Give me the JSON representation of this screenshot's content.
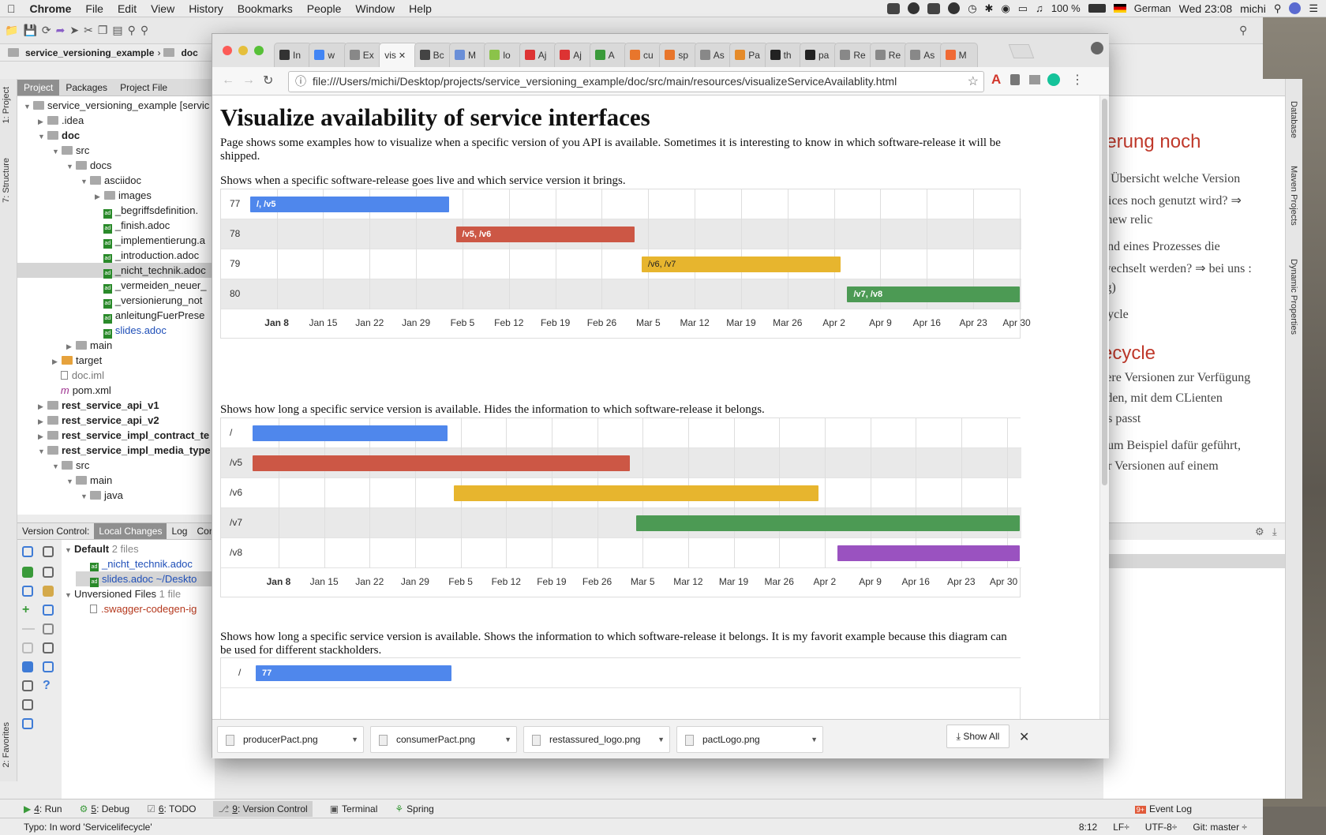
{
  "menubar": {
    "apple": "",
    "app": "Chrome",
    "items": [
      "File",
      "Edit",
      "View",
      "History",
      "Bookmarks",
      "People",
      "Window",
      "Help"
    ],
    "battery": "100 %",
    "input_lang": "German",
    "clock": "Wed 23:08",
    "user": "michi"
  },
  "ide": {
    "breadcrumb": [
      "service_versioning_example",
      "doc"
    ],
    "left_tabs": {
      "project": "1: Project",
      "structure": "7: Structure",
      "favorites": "2: Favorites"
    },
    "project_tabs": [
      "Project",
      "Packages",
      "Project File"
    ],
    "tree": [
      {
        "label": "service_versioning_example [servic",
        "depth": 0,
        "kind": "folder",
        "bold": false
      },
      {
        "label": ".idea",
        "depth": 1,
        "kind": "folder"
      },
      {
        "label": "doc",
        "depth": 1,
        "kind": "folder",
        "bold": true
      },
      {
        "label": "src",
        "depth": 2,
        "kind": "folder"
      },
      {
        "label": "docs",
        "depth": 3,
        "kind": "folder"
      },
      {
        "label": "asciidoc",
        "depth": 4,
        "kind": "folder"
      },
      {
        "label": "images",
        "depth": 5,
        "kind": "folder"
      },
      {
        "label": "_begriffsdefinition.",
        "depth": 5,
        "kind": "adoc"
      },
      {
        "label": "_finish.adoc",
        "depth": 5,
        "kind": "adoc"
      },
      {
        "label": "_implementierung.a",
        "depth": 5,
        "kind": "adoc"
      },
      {
        "label": "_introduction.adoc",
        "depth": 5,
        "kind": "adoc"
      },
      {
        "label": "_nicht_technik.adoc",
        "depth": 5,
        "kind": "adoc",
        "selected": true
      },
      {
        "label": "_vermeiden_neuer_",
        "depth": 5,
        "kind": "adoc"
      },
      {
        "label": "_versionierung_not",
        "depth": 5,
        "kind": "adoc"
      },
      {
        "label": "anleitungFuerPrese",
        "depth": 5,
        "kind": "adoc"
      },
      {
        "label": "slides.adoc",
        "depth": 5,
        "kind": "adoc",
        "blue": true
      },
      {
        "label": "main",
        "depth": 3,
        "kind": "folder"
      },
      {
        "label": "target",
        "depth": 2,
        "kind": "folder-orange"
      },
      {
        "label": "doc.iml",
        "depth": 2,
        "kind": "file"
      },
      {
        "label": "pom.xml",
        "depth": 2,
        "kind": "pom"
      },
      {
        "label": "rest_service_api_v1",
        "depth": 1,
        "kind": "folder",
        "bold": true
      },
      {
        "label": "rest_service_api_v2",
        "depth": 1,
        "kind": "folder",
        "bold": true
      },
      {
        "label": "rest_service_impl_contract_te",
        "depth": 1,
        "kind": "folder",
        "bold": true
      },
      {
        "label": "rest_service_impl_media_type",
        "depth": 1,
        "kind": "folder",
        "bold": true
      },
      {
        "label": "src",
        "depth": 2,
        "kind": "folder"
      },
      {
        "label": "main",
        "depth": 3,
        "kind": "folder"
      },
      {
        "label": "java",
        "depth": 4,
        "kind": "folder"
      }
    ],
    "vc_tabs": [
      "Version Control:",
      "Local Changes",
      "Log",
      "Con"
    ],
    "vc_list": {
      "default_label": "Default",
      "default_count": "2 files",
      "files": [
        "_nicht_technik.adoc",
        "slides.adoc ~/Deskto"
      ],
      "unversioned_label": "Unversioned Files",
      "unversioned_count": "1 file",
      "unversioned_files": [
        ".swagger-codegen-ig"
      ]
    },
    "bottom_tabs": [
      {
        "key": "4",
        "label": ": Run"
      },
      {
        "key": "5",
        "label": ": Debug"
      },
      {
        "key": "6",
        "label": ": TODO"
      },
      {
        "key": "9",
        "label": ": Version Control"
      },
      {
        "key": "",
        "label": "Terminal"
      },
      {
        "key": "",
        "label": "Spring"
      }
    ],
    "event_log": "Event Log",
    "status_text": "Typo: In word 'Servicelifecycle'",
    "status_right": [
      "8:12",
      "LF÷",
      "UTF-8÷",
      "Git: master ÷"
    ],
    "right_tabs": [
      "Database",
      "Maven Projects",
      "Dynamic Properties"
    ],
    "editor_lines": [
      {
        "text": "ierung noch",
        "style": "h"
      },
      {
        "text": "e Übersicht welche Version",
        "style": "p"
      },
      {
        "text": "vices noch genutzt wird? ⇒",
        "style": "p"
      },
      {
        "text": " (new relic",
        "style": "p"
      },
      {
        "text": "end eines Prozesses die",
        "style": "p"
      },
      {
        "text": "wechselt werden? ⇒ bei uns :",
        "style": "p"
      },
      {
        "text": "ig)",
        "style": "p"
      },
      {
        "text": "cycle",
        "style": "p"
      },
      {
        "text": "ecycle",
        "style": "h"
      },
      {
        "text": "rere Versionen zur Verfügung",
        "style": "p"
      },
      {
        "text": "rden, mit dem CLienten",
        "style": "p"
      },
      {
        "text": " es passt",
        "style": "p"
      },
      {
        "text": " zum Beispiel dafür geführt,",
        "style": "p"
      },
      {
        "text": "er Versionen auf einem",
        "style": "p"
      }
    ]
  },
  "browser": {
    "tabs": [
      "In",
      "w",
      "Ex",
      "vis",
      "Bc",
      "M",
      "lo",
      "Aj",
      "Aj",
      "A",
      "cu",
      "sp",
      "As",
      "Pa",
      "th",
      "pa",
      "Re",
      "Re",
      "As",
      "M"
    ],
    "active_tab": 3,
    "url": "file:///Users/michi/Desktop/projects/service_versioning_example/doc/src/main/resources/visualizeServiceAvailablity.html",
    "page_title": "Visualize availability of service interfaces",
    "intro": "Page shows some examples how to visualize when a specific version of you API is available. Sometimes it is interesting to know in which software-release it will be shipped.",
    "caption1": "Shows when a specific software-release goes live and which service version it brings.",
    "caption2": "Shows how long a specific service version is available. Hides the information to which software-release it belongs.",
    "caption3": "Shows how long a specific service version is available. Shows the information to which software-release it belongs. It is my favorit example because this diagram can be used for different stackholders.",
    "downloads": [
      "producerPact.png",
      "consumerPact.png",
      "restassured_logo.png",
      "pactLogo.png"
    ],
    "show_all": "Show All"
  },
  "chart_data": [
    {
      "type": "timeline",
      "x_ticks": [
        "Jan 8",
        "Jan 15",
        "Jan 22",
        "Jan 29",
        "Feb 5",
        "Feb 12",
        "Feb 19",
        "Feb 26",
        "Mar 5",
        "Mar 12",
        "Mar 19",
        "Mar 26",
        "Apr 2",
        "Apr 9",
        "Apr 16",
        "Apr 23",
        "Apr 30"
      ],
      "x_range": [
        "2017-01-04",
        "2017-04-30"
      ],
      "rows": [
        {
          "row": "77",
          "label": "/, /v5",
          "start": "2017-01-04",
          "end": "2017-02-03",
          "color": "#4f87ec"
        },
        {
          "row": "78",
          "label": "/v5, /v6",
          "start": "2017-02-04",
          "end": "2017-03-03",
          "color": "#cc5745"
        },
        {
          "row": "79",
          "label": "/v6, /v7",
          "start": "2017-03-04",
          "end": "2017-04-03",
          "color": "#e7b52e"
        },
        {
          "row": "80",
          "label": "/v7, /v8",
          "start": "2017-04-04",
          "end": "2017-04-30",
          "color": "#4c9a54"
        }
      ]
    },
    {
      "type": "timeline",
      "x_ticks": [
        "Jan 8",
        "Jan 15",
        "Jan 22",
        "Jan 29",
        "Feb 5",
        "Feb 12",
        "Feb 19",
        "Feb 26",
        "Mar 5",
        "Mar 12",
        "Mar 19",
        "Mar 26",
        "Apr 2",
        "Apr 9",
        "Apr 16",
        "Apr 23",
        "Apr 30"
      ],
      "x_range": [
        "2017-01-04",
        "2017-05-02"
      ],
      "rows": [
        {
          "row": "/",
          "label": "",
          "start": "2017-01-04",
          "end": "2017-02-03",
          "color": "#4f87ec"
        },
        {
          "row": "/v5",
          "label": "",
          "start": "2017-01-04",
          "end": "2017-03-03",
          "color": "#cc5745"
        },
        {
          "row": "/v6",
          "label": "",
          "start": "2017-02-04",
          "end": "2017-04-01",
          "color": "#e7b52e"
        },
        {
          "row": "/v7",
          "label": "",
          "start": "2017-03-04",
          "end": "2017-05-02",
          "color": "#4c9a54"
        },
        {
          "row": "/v8",
          "label": "",
          "start": "2017-04-04",
          "end": "2017-05-02",
          "color": "#9a52c0"
        }
      ]
    },
    {
      "type": "timeline",
      "rows": [
        {
          "row": "/",
          "label": "77",
          "color": "#4f87ec"
        }
      ]
    }
  ]
}
